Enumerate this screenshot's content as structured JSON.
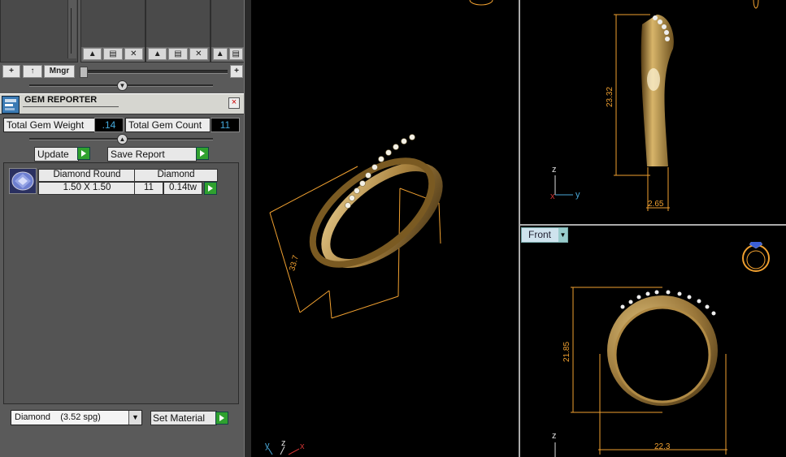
{
  "toolbar": {
    "add_label": "+",
    "up_label": "↑",
    "manager_label": "Mngr",
    "plus_label": "+"
  },
  "slots": [
    {
      "btn_icons": [
        "up-icon",
        "save-icon",
        "close-icon"
      ]
    },
    {
      "btn_icons": [
        "up-icon",
        "save-icon",
        "close-icon"
      ]
    },
    {
      "btn_icons": [
        "up-icon",
        "save-icon"
      ]
    }
  ],
  "gem_reporter": {
    "title": "GEM REPORTER",
    "close": "×",
    "total_weight_label": "Total Gem Weight",
    "total_weight_value": ".14",
    "total_count_label": "Total Gem Count",
    "total_count_value": "11",
    "update_label": "Update",
    "save_report_label": "Save Report",
    "gems": [
      {
        "shape": "Diamond Round",
        "size": "1.50 X 1.50",
        "material": "Diamond",
        "count": "11",
        "weight": "0.14tw"
      }
    ],
    "material_select": {
      "name": "Diamond",
      "spg": "(3.52 spg)"
    },
    "set_material_label": "Set Material"
  },
  "viewports": {
    "front_label": "Front",
    "dimensions": {
      "perspective": "33.7",
      "side_height": "23.32",
      "side_width": "2.65",
      "front_height": "21.85",
      "front_width": "22.3"
    },
    "axes": {
      "x": "x",
      "y": "y",
      "z": "z"
    }
  },
  "colors": {
    "panel_bg": "#5a5a5a",
    "accent_value": "#44aadd",
    "dimension": "#f0a030",
    "ring_gold": "#b08a45",
    "go_green": "#2fa12f"
  }
}
